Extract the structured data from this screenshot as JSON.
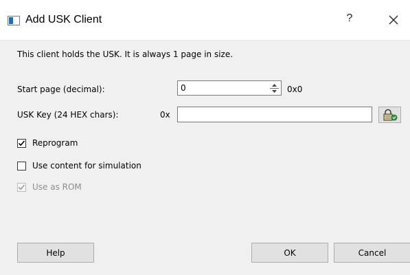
{
  "dialog": {
    "title": "Add USK Client",
    "help_glyph": "?",
    "description": "This client holds the USK. It is always 1 page in size."
  },
  "start_page": {
    "label": "Start page (decimal):",
    "value": "0",
    "hex_readout": "0x0"
  },
  "usk_key": {
    "label": "USK Key (24 HEX chars):",
    "prefix": "0x",
    "value": "",
    "lock_icon": "lock-icon"
  },
  "options": {
    "reprogram": {
      "label": "Reprogram",
      "checked": true,
      "enabled": true
    },
    "simulation": {
      "label": "Use content for simulation",
      "checked": false,
      "enabled": true
    },
    "rom": {
      "label": "Use as ROM",
      "checked": true,
      "enabled": false
    }
  },
  "buttons": {
    "help": "Help",
    "ok": "OK",
    "cancel": "Cancel"
  },
  "colors": {
    "dialog_bg": "#f0f0f0",
    "titlebar_bg": "#ffffff",
    "accent": "#1a6fc2",
    "disabled_text": "#8d8d8d"
  }
}
